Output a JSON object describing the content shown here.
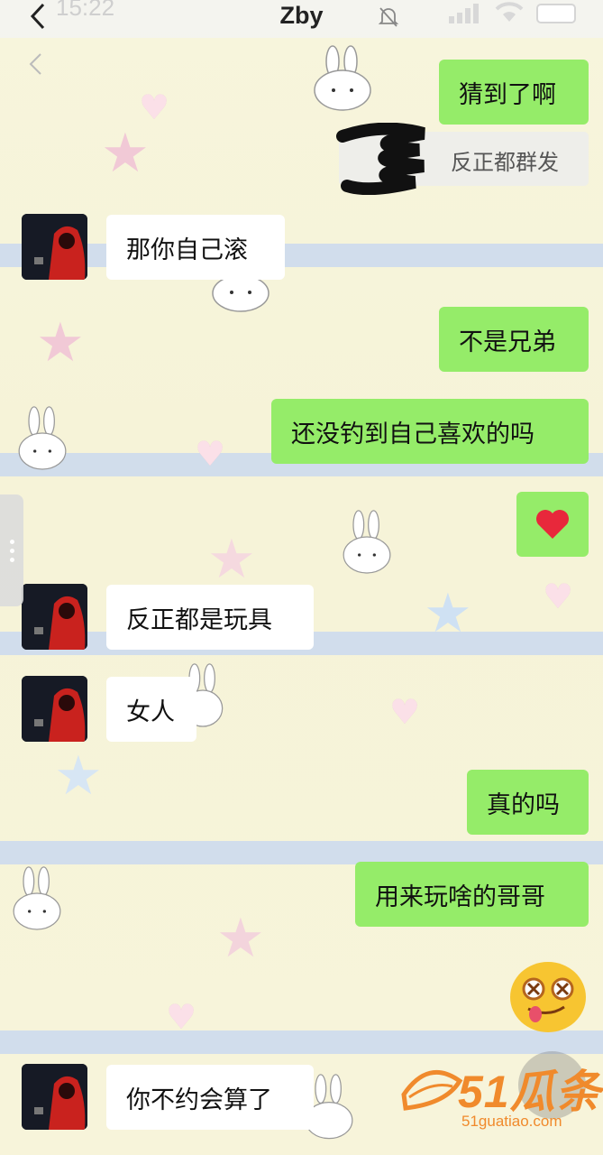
{
  "status_bar": {
    "time": "15:22"
  },
  "nav": {
    "title": "Zby"
  },
  "colors": {
    "outgoing_bubble": "#95ec69",
    "incoming_bubble": "#ffffff",
    "watermark": "#f08a2c"
  },
  "quote": {
    "text": "反正都群发"
  },
  "messages": [
    {
      "side": "out",
      "text": "猜到了啊"
    },
    {
      "side": "in",
      "text": "那你自己滚"
    },
    {
      "side": "out",
      "text": "不是兄弟"
    },
    {
      "side": "out",
      "text": "还没钓到自己喜欢的吗"
    },
    {
      "side": "out",
      "type": "emoji",
      "icon": "red-heart-emoji"
    },
    {
      "side": "in",
      "text": "反正都是玩具"
    },
    {
      "side": "in",
      "text": "女人"
    },
    {
      "side": "out",
      "text": "真的吗"
    },
    {
      "side": "out",
      "text": "用来玩啥的哥哥"
    },
    {
      "side": "out",
      "type": "emoji",
      "icon": "dizzy-eyes-tongue-emoji"
    },
    {
      "side": "in",
      "text": "你不约会算了"
    }
  ],
  "watermark": {
    "logo_text": "51瓜条",
    "url": "51guatiao.com"
  }
}
